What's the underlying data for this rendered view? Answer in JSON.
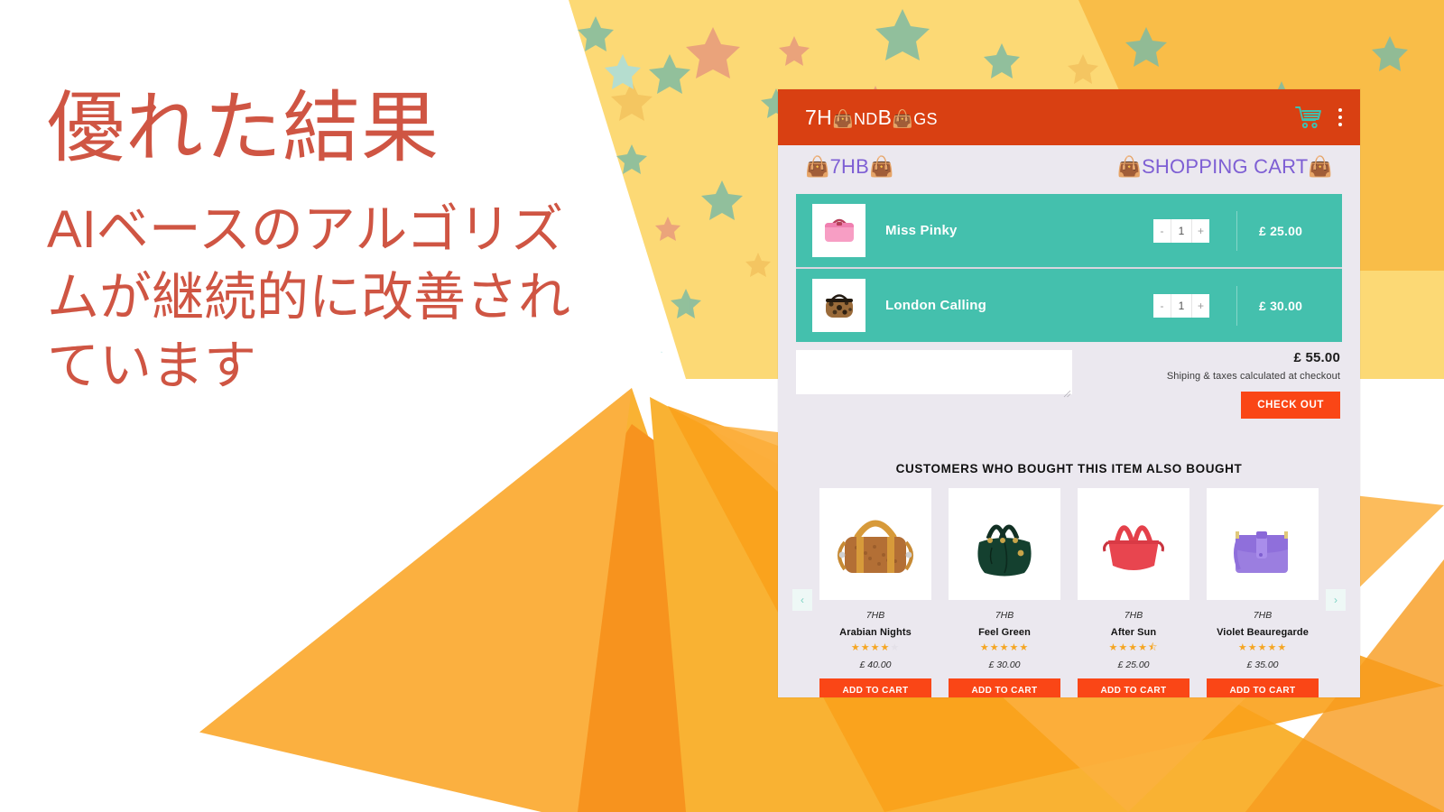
{
  "promo": {
    "headline": "優れた結果",
    "subhead": "AIベースのアルゴリズムが継続的に改善されています",
    "accent_color": "#cf5543"
  },
  "colors": {
    "appbar": "#d94012",
    "panel_bg": "#ebe8ef",
    "cart_teal": "#44c0ad",
    "cta_orange": "#fa4616",
    "crumb_purple": "#7e5fd4",
    "star_gold": "#f5a623",
    "bg_yellow": "#fcd975",
    "bg_orange": "#f79b1e"
  },
  "appbar": {
    "logo_prefix": "7H",
    "logo_mid": "ND",
    "logo_suffix": "GS",
    "logo_bag_glyph": "👜",
    "logo_full": "7HANDBAGS",
    "cart_icon": "shopping-cart-icon",
    "menu_icon": "kebab-menu-icon"
  },
  "breadcrumb": {
    "left": "7HB",
    "right": "SHOPPING CART",
    "bag_glyph": "👜"
  },
  "cart": {
    "items": [
      {
        "name": "Miss Pinky",
        "qty": "1",
        "price": "£ 25.00",
        "thumb": "pink-handbag-thumb",
        "decrement": "-",
        "increment": "+"
      },
      {
        "name": "London Calling",
        "qty": "1",
        "price": "£ 30.00",
        "thumb": "leopard-handbag-thumb",
        "decrement": "-",
        "increment": "+"
      }
    ],
    "note_value": "",
    "note_placeholder": "",
    "grand_total": "£ 55.00",
    "tax_note": "Shiping & taxes calculated at checkout",
    "checkout_label": "CHECK OUT"
  },
  "recommendations": {
    "title": "CUSTOMERS WHO BOUGHT THIS ITEM ALSO BOUGHT",
    "prev_label": "‹",
    "next_label": "›",
    "add_to_cart_label": "ADD TO CART",
    "products": [
      {
        "brand": "7HB",
        "name": "Arabian Nights",
        "price": "£ 40.00",
        "rating": 4,
        "rating_text": "4 out of 5",
        "image": "tan-satchel-image"
      },
      {
        "brand": "7HB",
        "name": "Feel Green",
        "price": "£ 30.00",
        "rating": 5,
        "rating_text": "5 out of 5",
        "image": "green-handbag-image"
      },
      {
        "brand": "7HB",
        "name": "After Sun",
        "price": "£ 25.00",
        "rating": 4.5,
        "rating_text": "4.5 out of 5",
        "image": "red-tote-image"
      },
      {
        "brand": "7HB",
        "name": "Violet Beauregarde",
        "price": "£ 35.00",
        "rating": 5,
        "rating_text": "5 out of 5",
        "image": "purple-satchel-image"
      }
    ]
  }
}
